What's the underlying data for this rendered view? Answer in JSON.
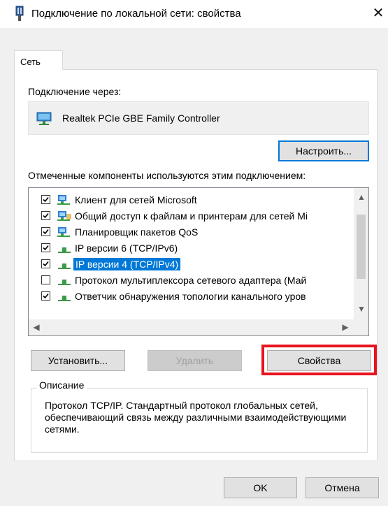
{
  "window": {
    "title": "Подключение по локальной сети: свойства",
    "close_glyph": "✕"
  },
  "tab": {
    "label": "Сеть"
  },
  "connect_via": {
    "label": "Подключение через:",
    "adapter": "Realtek PCIe GBE Family Controller",
    "configure_button": "Настроить..."
  },
  "components": {
    "label": "Отмеченные компоненты используются этим подключением:",
    "items": [
      {
        "label": "Клиент для сетей Microsoft",
        "checked": true,
        "icon": "network-client-icon",
        "selected": false
      },
      {
        "label": "Общий доступ к файлам и принтерам для сетей Mi",
        "checked": true,
        "icon": "file-sharing-icon",
        "selected": false
      },
      {
        "label": "Планировщик пакетов QoS",
        "checked": true,
        "icon": "qos-icon",
        "selected": false
      },
      {
        "label": "IP версии 6 (TCP/IPv6)",
        "checked": true,
        "icon": "protocol-icon",
        "selected": false
      },
      {
        "label": "IP версии 4 (TCP/IPv4)",
        "checked": true,
        "icon": "protocol-icon",
        "selected": true
      },
      {
        "label": "Протокол мультиплексора сетевого адаптера (Май",
        "checked": false,
        "icon": "protocol-icon",
        "selected": false
      },
      {
        "label": "Ответчик обнаружения топологии канального уров",
        "checked": true,
        "icon": "protocol-icon",
        "selected": false
      }
    ]
  },
  "buttons": {
    "install": "Установить...",
    "remove": "Удалить",
    "properties": "Свойства",
    "ok": "OK",
    "cancel": "Отмена"
  },
  "description": {
    "title": "Описание",
    "text": "Протокол TCP/IP. Стандартный протокол глобальных сетей, обеспечивающий связь между различными взаимодействующими сетями."
  },
  "colors": {
    "selection": "#0078d7",
    "highlight_frame": "#e8141e",
    "window_bg": "#f0f0f0"
  }
}
